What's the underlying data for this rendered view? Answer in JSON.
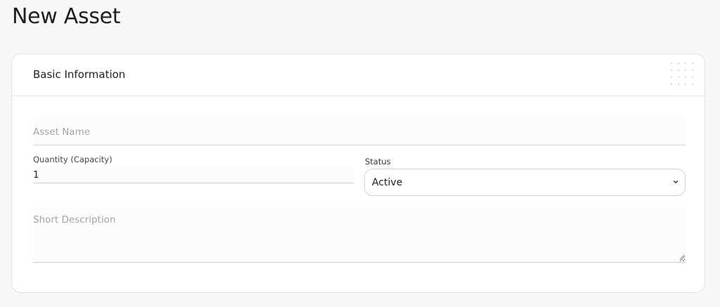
{
  "page": {
    "title": "New Asset"
  },
  "card": {
    "title": "Basic Information"
  },
  "form": {
    "asset_name": {
      "value": "",
      "placeholder": "Asset Name"
    },
    "quantity": {
      "label": "Quantity (Capacity)",
      "value": "1"
    },
    "status": {
      "label": "Status",
      "selected": "Active"
    },
    "description": {
      "value": "",
      "placeholder": "Short Description"
    }
  },
  "icons": {
    "select_arrow": "chevron-down-icon",
    "resize": "resize-handle-icon",
    "decoration": "dot-grid"
  },
  "colors": {
    "background": "#f7f7f7",
    "card": "#ffffff",
    "border": "#e2e2e2",
    "placeholder": "#a4a4a4",
    "text": "#222222"
  }
}
